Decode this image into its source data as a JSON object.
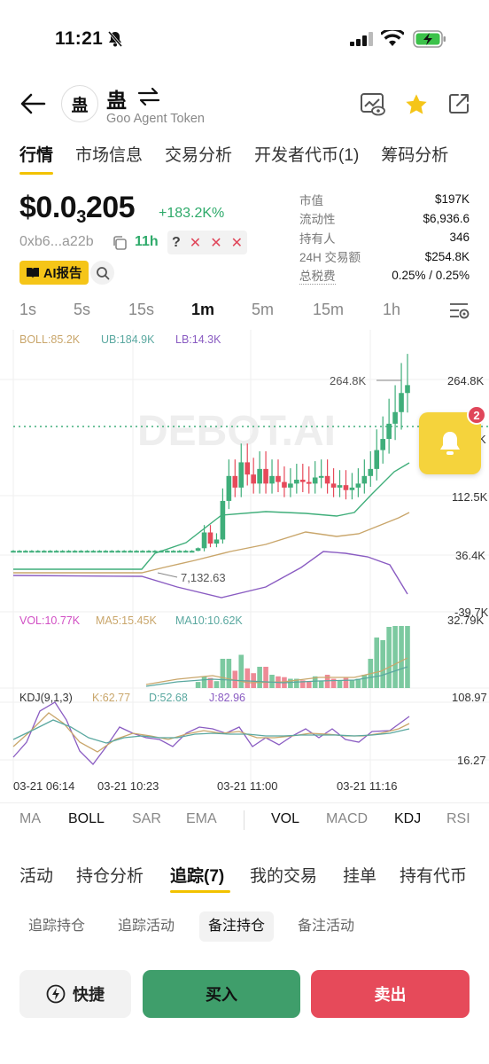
{
  "status_bar": {
    "time": "11:21"
  },
  "header": {
    "token_avatar": "蛊",
    "token_symbol": "蛊",
    "token_name": "Goo Agent Token"
  },
  "main_tabs": [
    "行情",
    "市场信息",
    "交易分析",
    "开发者代币(1)",
    "筹码分析"
  ],
  "price": {
    "prefix": "$0.0",
    "subscript": "3",
    "suffix": "205",
    "change": "+183.2K%",
    "address": "0xb6...a22b",
    "age": "11h",
    "flags_q": "?",
    "flags_x": [
      "✕",
      "✕",
      "✕"
    ],
    "ai_report": "AI报告"
  },
  "stats": [
    {
      "label": "市值",
      "value": "$197K"
    },
    {
      "label": "流动性",
      "value": "$6,936.6"
    },
    {
      "label": "持有人",
      "value": "346"
    },
    {
      "label": "24H 交易额",
      "value": "$254.8K"
    },
    {
      "label": "总税费",
      "value": "0.25% / 0.25%"
    }
  ],
  "intervals": [
    "1s",
    "5s",
    "15s",
    "1m",
    "5m",
    "15m",
    "1h"
  ],
  "active_interval": "1m",
  "chart": {
    "boll_label": "BOLL:85.2K",
    "ub_label": "UB:184.9K",
    "lb_label": "LB:14.3K",
    "max_label": "264.8K",
    "min_label": "7,132.63",
    "watermark": "DEBOT.AI",
    "y_axis": [
      "264.8K",
      "K",
      "112.5K",
      "36.4K",
      "-39.7K"
    ],
    "vol_label": "VOL:10.77K",
    "ma5_label": "MA5:15.45K",
    "ma10_label": "MA10:10.62K",
    "vol_axis_top": "32.79K",
    "kdj_label": "KDJ(9,1,3)",
    "k_label": "K:62.77",
    "d_label": "D:52.68",
    "j_label": "J:82.96",
    "kdj_axis_top": "108.97",
    "kdj_axis_bottom": "16.27",
    "x_axis": [
      "03-21 06:14",
      "03-21 10:23",
      "03-21 11:00",
      "03-21 11:16"
    ],
    "alert_badge": "2"
  },
  "indicators": [
    "MA",
    "BOLL",
    "SAR",
    "EMA",
    "VOL",
    "MACD",
    "KDJ",
    "RSI"
  ],
  "sub_tabs": [
    "活动",
    "持仓分析",
    "追踪(7)",
    "我的交易",
    "挂单",
    "持有代币"
  ],
  "chips": [
    "追踪持仓",
    "追踪活动",
    "备注持仓",
    "备注活动"
  ],
  "buttons": {
    "quick": "快捷",
    "buy": "买入",
    "sell": "卖出"
  },
  "colors": {
    "up": "#3fae7a",
    "down": "#e64a5a",
    "accent": "#f5c518"
  },
  "chart_data": {
    "type": "candlestick",
    "candles_close_approx_k": [
      5,
      5,
      5,
      5,
      5,
      5,
      5,
      5,
      5,
      5,
      5,
      5,
      5,
      5,
      5,
      5,
      5,
      5,
      5,
      5,
      5,
      5,
      5,
      5,
      5,
      5,
      5,
      5,
      5,
      5,
      6,
      14,
      8,
      10,
      40,
      70,
      55,
      90,
      72,
      60,
      80,
      60,
      70,
      62,
      55,
      60,
      65,
      62,
      60,
      68,
      70,
      60,
      55,
      58,
      52,
      55,
      60,
      70,
      80,
      110,
      130,
      160,
      185,
      230,
      250
    ]
  }
}
